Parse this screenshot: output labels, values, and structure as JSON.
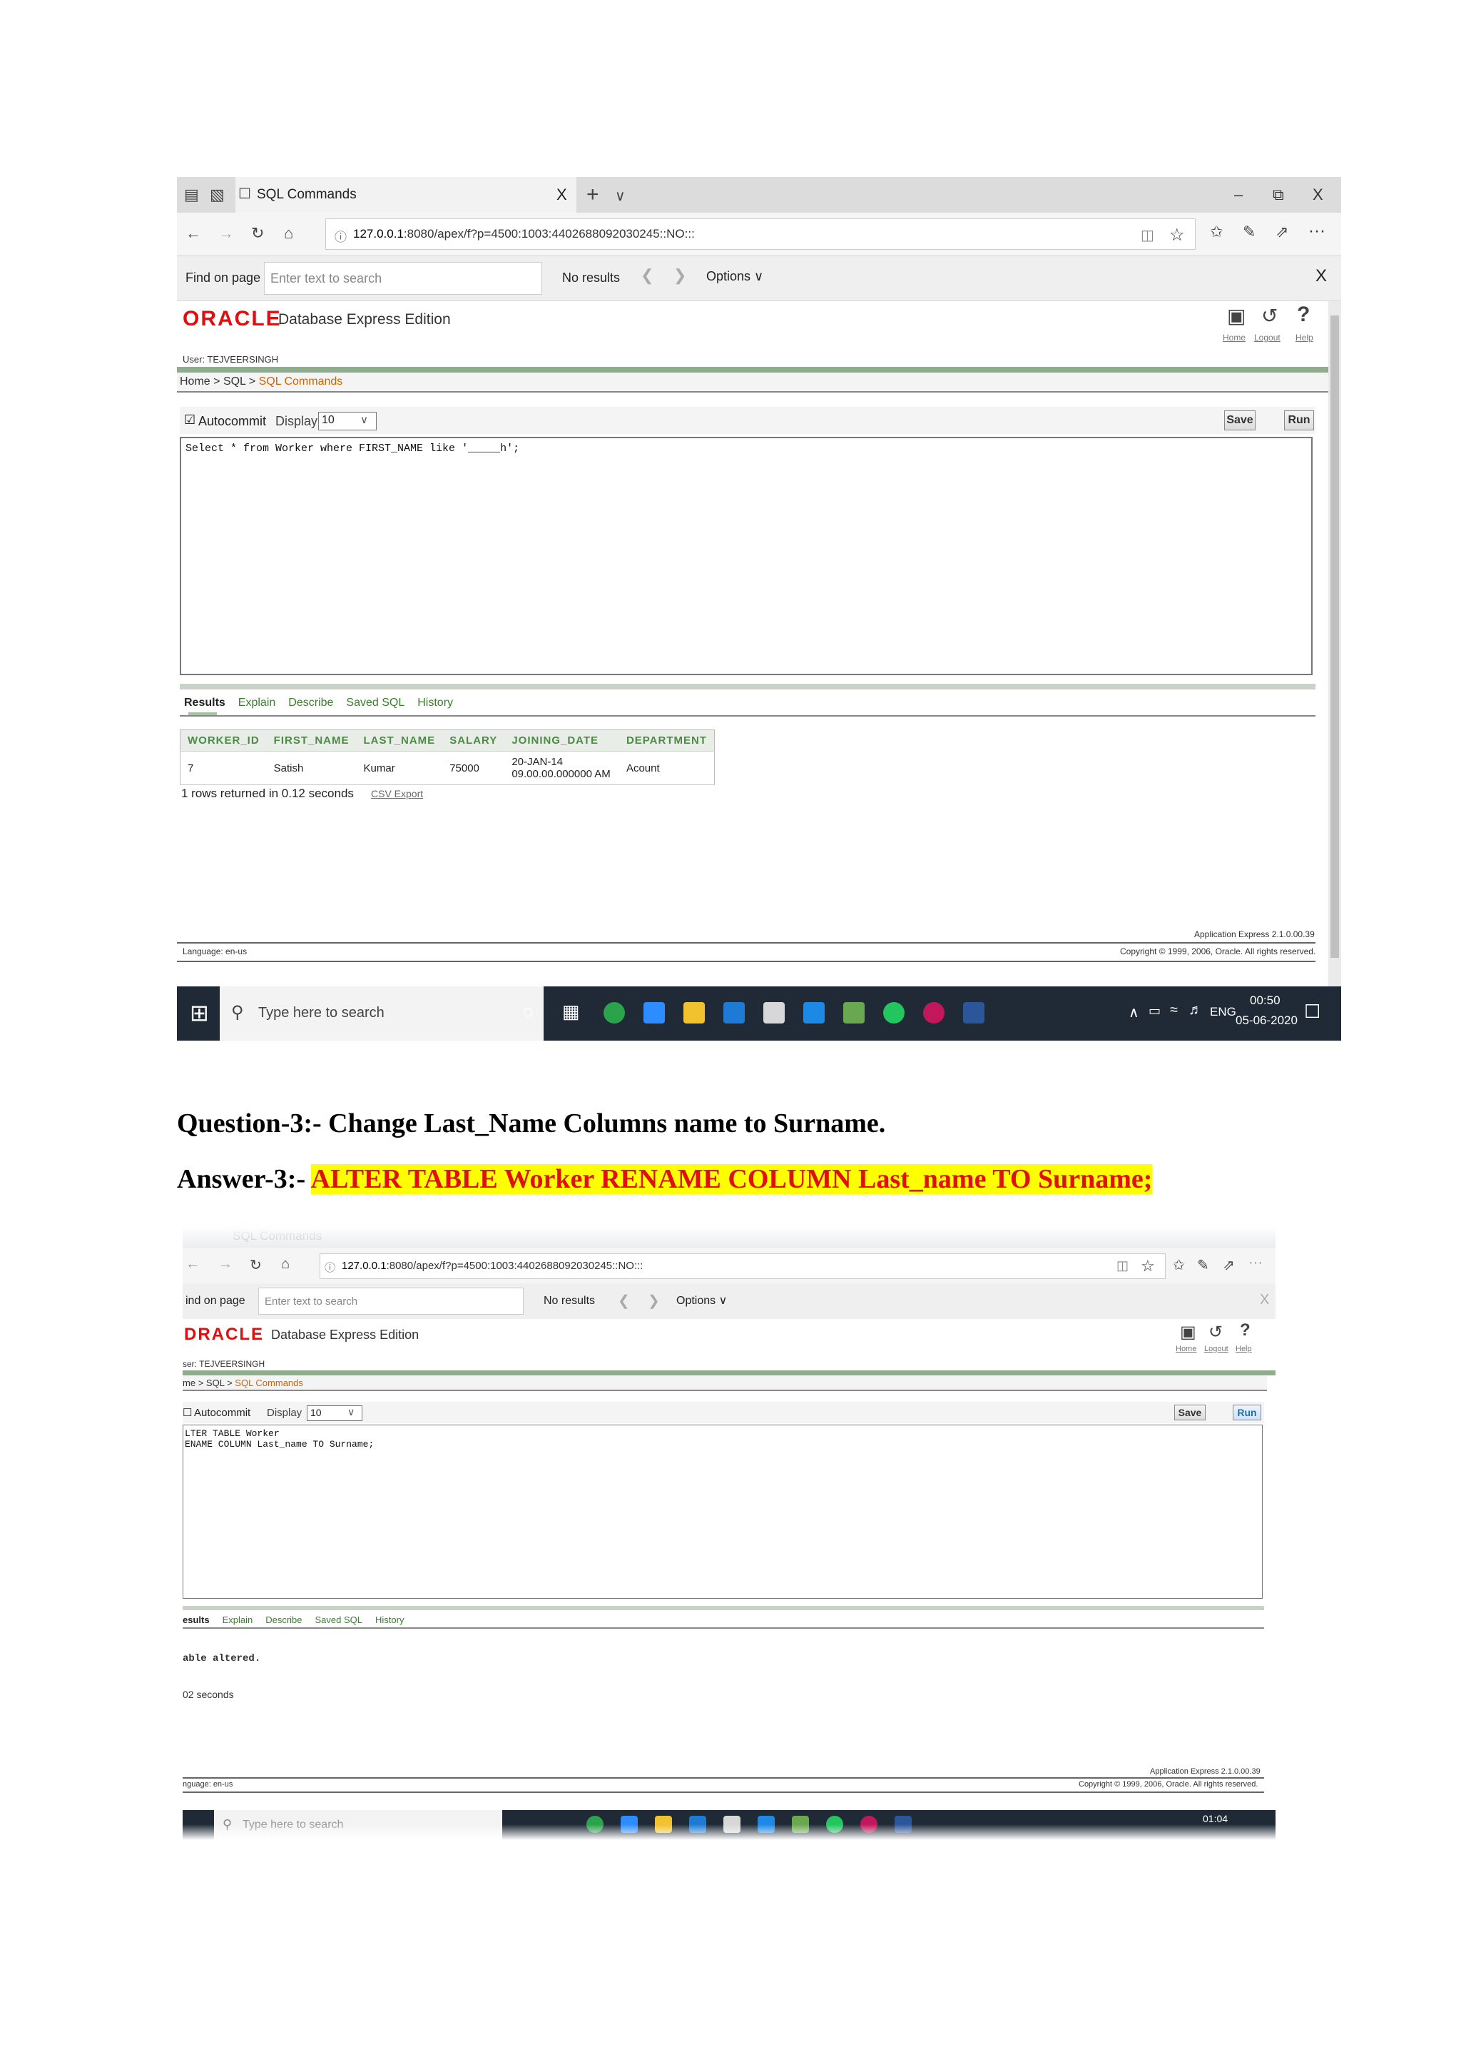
{
  "browser": {
    "tab_title": "SQL Commands",
    "tab_close": "X",
    "new_tab": "+",
    "tab_dropdown": "∨",
    "win_min": "–",
    "win_restore": "⧉",
    "win_close": "X",
    "url_host": "127.0.0.1",
    "url_path": ":8080/apex/f?p=4500:1003:4402688092030245::NO:::",
    "url_path2": ":8080/apex/f?p=4500:1003:4402688092030245::NO:::",
    "find_label": "Find on page",
    "find_label_cropped": "ind on page",
    "find_placeholder": "Enter text to search",
    "find_status": "No results",
    "find_options": "Options",
    "find_close": "X",
    "more": "···"
  },
  "apex": {
    "logo": "ORACLE",
    "logo_cropped": "DRACLE",
    "product": "Database Express Edition",
    "user": "User: TEJVEERSINGH",
    "user_cropped": "ser: TEJVEERSINGH",
    "nav_home": "Home",
    "nav_logout": "Logout",
    "nav_help": "Help",
    "crumb_home": "Home",
    "crumb_home_cropped": "me",
    "crumb_sep": ">",
    "crumb_sql": "SQL",
    "crumb_current": "SQL Commands",
    "autocommit": "Autocommit",
    "display_label": "Display",
    "display_value": "10",
    "save": "Save",
    "run": "Run",
    "tabs": [
      "Results",
      "Explain",
      "Describe",
      "Saved SQL",
      "History"
    ],
    "tab_results_cropped": "esults",
    "footer_language": "Language: en-us",
    "footer_language_cropped": "nguage: en-us",
    "footer_version": "Application Express 2.1.0.00.39",
    "footer_copyright": "Copyright © 1999, 2006, Oracle. All rights reserved."
  },
  "shot1": {
    "sql": "Select * from Worker where FIRST_NAME like '_____h';",
    "columns": [
      "WORKER_ID",
      "FIRST_NAME",
      "LAST_NAME",
      "SALARY",
      "JOINING_DATE",
      "DEPARTMENT"
    ],
    "row": [
      "7",
      "Satish",
      "Kumar",
      "75000",
      "20-JAN-14 09.00.00.000000 AM",
      "Acount"
    ],
    "rows_returned": "1 rows returned in 0.12 seconds",
    "csv_export": "CSV Export",
    "clock_time": "00:50",
    "clock_date": "05-06-2020"
  },
  "shot2": {
    "sql_line1": "LTER TABLE Worker",
    "sql_line2": "ENAME COLUMN Last_name TO Surname;",
    "result_message": "able altered.",
    "result_time": "02 seconds",
    "clock_time": "01:04",
    "taskbar_search": "Type here to search"
  },
  "taskbar": {
    "search_placeholder": "Type here to search",
    "lang": "ENG",
    "tray_caret": "∧"
  },
  "document": {
    "question": "Question-3:- Change Last_Name Columns name to  Surname.",
    "answer_label": "Answer-3:-",
    "answer_sql": "ALTER TABLE Worker RENAME COLUMN Last_name TO Surname;"
  },
  "colors": {
    "oracle_red": "#e30d0d",
    "apex_green": "#3a7d2c",
    "highlight": "#ffff00",
    "answer_red": "#e01010"
  }
}
